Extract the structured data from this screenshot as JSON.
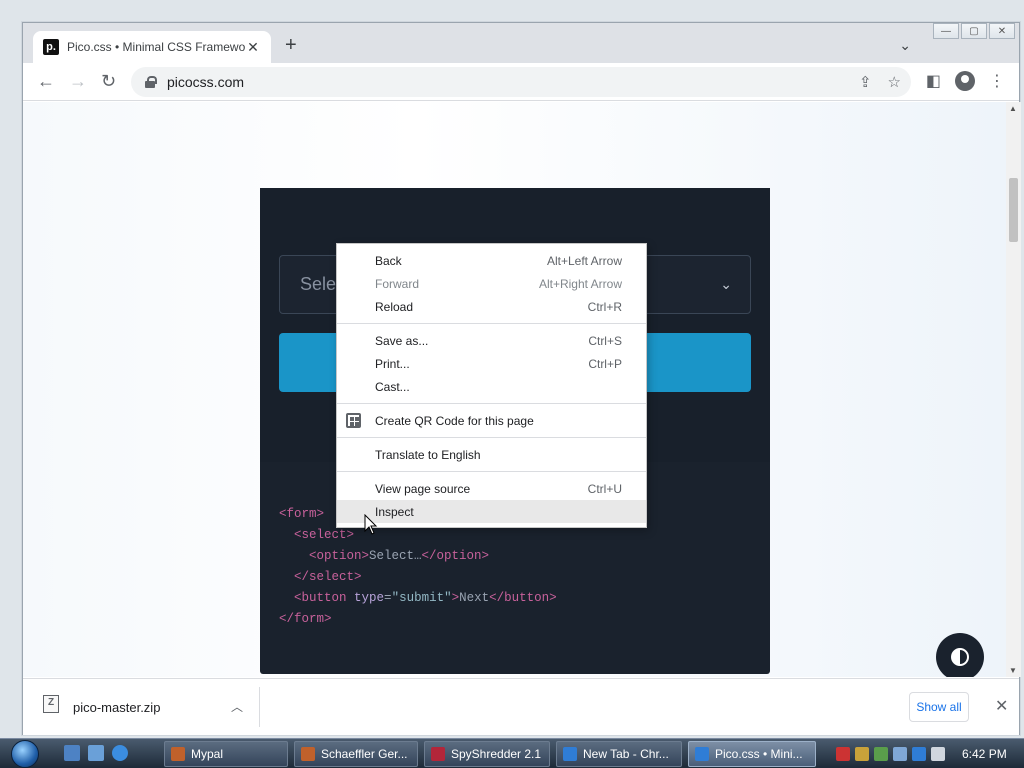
{
  "browser": {
    "tab_title": "Pico.css • Minimal CSS Framewor",
    "favicon_letter": "p.",
    "url": "picocss.com",
    "new_tab_glyph": "+",
    "close_glyph": "✕"
  },
  "page": {
    "select_placeholder": "Selec",
    "code_lines": [
      {
        "indent": "",
        "parts": [
          {
            "t": "<form>",
            "c": "tag"
          }
        ]
      },
      {
        "indent": "  ",
        "parts": [
          {
            "t": "<select>",
            "c": "tag"
          }
        ]
      },
      {
        "indent": "    ",
        "parts": [
          {
            "t": "<option>",
            "c": "tag"
          },
          {
            "t": "Select…",
            "c": "txt"
          },
          {
            "t": "</option>",
            "c": "tag"
          }
        ]
      },
      {
        "indent": "  ",
        "parts": [
          {
            "t": "</select>",
            "c": "tag"
          }
        ]
      },
      {
        "indent": "  ",
        "parts": [
          {
            "t": "<button",
            "c": "tag"
          },
          {
            "t": " type",
            "c": "attr"
          },
          {
            "t": "=",
            "c": "txt"
          },
          {
            "t": "\"submit\"",
            "c": "str"
          },
          {
            "t": ">",
            "c": "tag"
          },
          {
            "t": "Next",
            "c": "txt"
          },
          {
            "t": "</button>",
            "c": "tag"
          }
        ]
      },
      {
        "indent": "",
        "parts": [
          {
            "t": "</form>",
            "c": "tag"
          }
        ]
      }
    ]
  },
  "context_menu": {
    "groups": [
      [
        {
          "label": "Back",
          "shortcut": "Alt+Left Arrow",
          "disabled": false
        },
        {
          "label": "Forward",
          "shortcut": "Alt+Right Arrow",
          "disabled": true
        },
        {
          "label": "Reload",
          "shortcut": "Ctrl+R",
          "disabled": false
        }
      ],
      [
        {
          "label": "Save as...",
          "shortcut": "Ctrl+S",
          "disabled": false
        },
        {
          "label": "Print...",
          "shortcut": "Ctrl+P",
          "disabled": false
        },
        {
          "label": "Cast...",
          "shortcut": "",
          "disabled": false
        }
      ],
      [
        {
          "label": "Create QR Code for this page",
          "shortcut": "",
          "disabled": false,
          "icon": "qr-code-icon"
        }
      ],
      [
        {
          "label": "Translate to English",
          "shortcut": "",
          "disabled": false
        }
      ],
      [
        {
          "label": "View page source",
          "shortcut": "Ctrl+U",
          "disabled": false
        },
        {
          "label": "Inspect",
          "shortcut": "",
          "disabled": false,
          "hovered": true
        }
      ]
    ]
  },
  "download_shelf": {
    "file_name": "pico-master.zip",
    "show_all_label": "Show all"
  },
  "taskbar": {
    "items": [
      {
        "label": "Mypal",
        "color": "#c0612b"
      },
      {
        "label": "Schaeffler Ger...",
        "color": "#c0612b"
      },
      {
        "label": "SpyShredder 2.1",
        "color": "#b3263a"
      },
      {
        "label": "New Tab - Chr...",
        "color": "#2f7dd6"
      },
      {
        "label": "Pico.css • Mini...",
        "color": "#2f7dd6",
        "active": true
      }
    ],
    "clock": "6:42 PM"
  },
  "colors": {
    "card_bg": "#1a222d",
    "primary_button": "#1a95c8",
    "code_tag": "#c8619b"
  }
}
